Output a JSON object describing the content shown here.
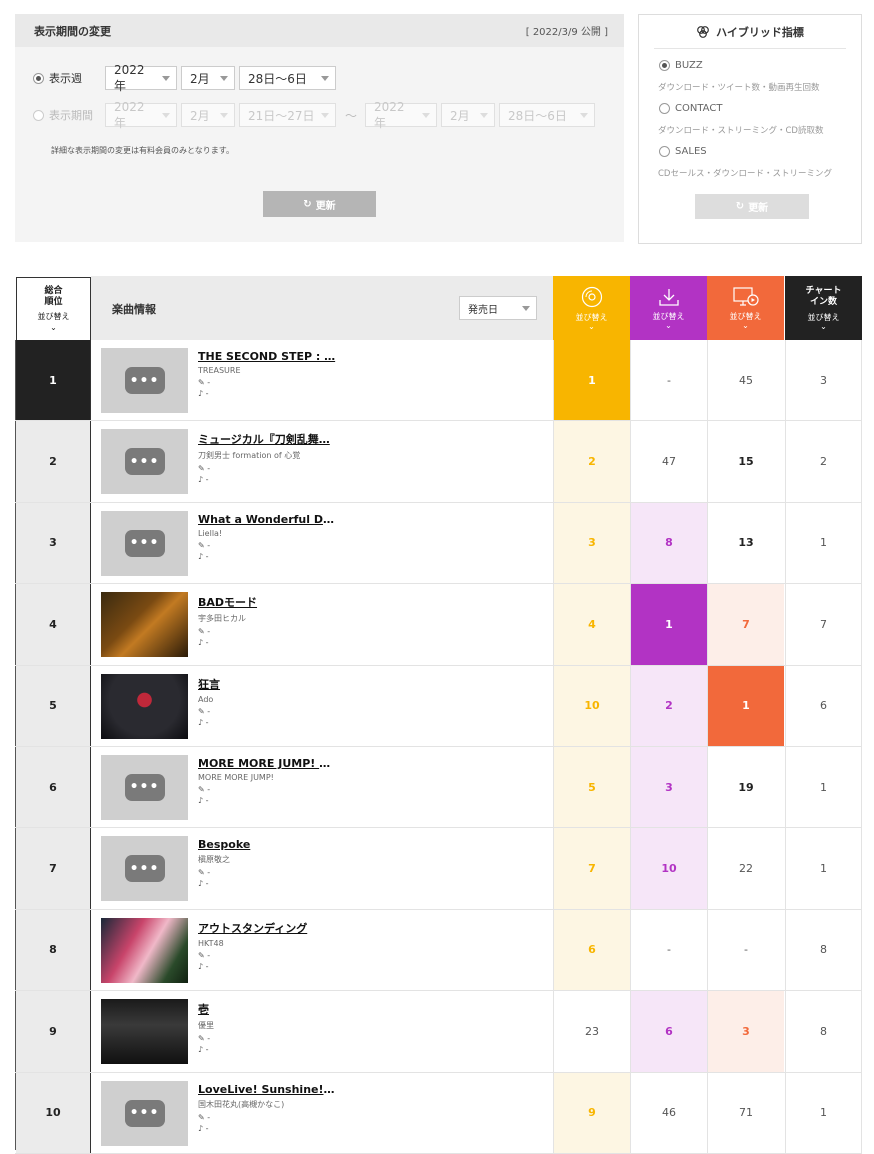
{
  "period": {
    "title": "表示期間の変更",
    "published": "[ 2022/3/9 公開 ]",
    "week_label": "表示週",
    "week": {
      "year": "2022年",
      "month": "2月",
      "range": "28日〜6日"
    },
    "span_label": "表示期間",
    "span_from": {
      "year": "2022年",
      "month": "2月",
      "range": "21日〜27日"
    },
    "span_sep": "〜",
    "span_to": {
      "year": "2022年",
      "month": "2月",
      "range": "28日〜6日"
    },
    "note": "詳細な表示期間の変更は有料会員のみとなります。",
    "update_label": "更新"
  },
  "hybrid": {
    "title": "ハイブリッド指標",
    "options": [
      {
        "label": "BUZZ",
        "desc": "ダウンロード・ツイート数・動画再生回数",
        "selected": true
      },
      {
        "label": "CONTACT",
        "desc": "ダウンロード・ストリーミング・CD読取数",
        "selected": false
      },
      {
        "label": "SALES",
        "desc": "CDセールス・ダウンロード・ストリーミング",
        "selected": false
      }
    ],
    "update_label": "更新"
  },
  "table": {
    "rank_header": [
      "総合",
      "順位"
    ],
    "sort_label": "並び替え",
    "song_header": "楽曲情報",
    "sort_select": "発売日",
    "chart_in_header": [
      "チャート",
      "イン数"
    ],
    "icons": {
      "cd": "cd-icon",
      "download": "download-icon",
      "streaming": "streaming-icon"
    },
    "colors": {
      "cd": "#f8b500",
      "download": "#b233c4",
      "streaming": "#f2693b",
      "chart_in": "#222222"
    }
  },
  "rows": [
    {
      "rank": "1",
      "title": "THE SECOND STEP : …",
      "artist": "TREASURE",
      "lyricist": "-",
      "composer": "-",
      "cd": "1",
      "dl": "-",
      "st": "45",
      "in": "3"
    },
    {
      "rank": "2",
      "title": "ミュージカル『刀剣乱舞…",
      "artist": "刀剣男士 formation of 心覚",
      "lyricist": "-",
      "composer": "-",
      "cd": "2",
      "dl": "47",
      "st": "15",
      "in": "2"
    },
    {
      "rank": "3",
      "title": "What a Wonderful Dre…",
      "artist": "Liella!",
      "lyricist": "-",
      "composer": "-",
      "cd": "3",
      "dl": "8",
      "st": "13",
      "in": "1"
    },
    {
      "rank": "4",
      "title": "BADモード",
      "artist": "宇多田ヒカル",
      "lyricist": "-",
      "composer": "-",
      "cd": "4",
      "dl": "1",
      "st": "7",
      "in": "7"
    },
    {
      "rank": "5",
      "title": "狂言",
      "artist": "Ado",
      "lyricist": "-",
      "composer": "-",
      "cd": "10",
      "dl": "2",
      "st": "1",
      "in": "6"
    },
    {
      "rank": "6",
      "title": "MORE MORE JUMP! S…",
      "artist": "MORE MORE JUMP!",
      "lyricist": "-",
      "composer": "-",
      "cd": "5",
      "dl": "3",
      "st": "19",
      "in": "1"
    },
    {
      "rank": "7",
      "title": "Bespoke",
      "artist": "槇原敬之",
      "lyricist": "-",
      "composer": "-",
      "cd": "7",
      "dl": "10",
      "st": "22",
      "in": "1"
    },
    {
      "rank": "8",
      "title": "アウトスタンディング",
      "artist": "HKT48",
      "lyricist": "-",
      "composer": "-",
      "cd": "6",
      "dl": "-",
      "st": "-",
      "in": "8"
    },
    {
      "rank": "9",
      "title": "壱",
      "artist": "優里",
      "lyricist": "-",
      "composer": "-",
      "cd": "23",
      "dl": "6",
      "st": "3",
      "in": "8"
    },
    {
      "rank": "10",
      "title": "LoveLive! Sunshine!! …",
      "artist": "国木田花丸(高槻かなこ)",
      "lyricist": "-",
      "composer": "-",
      "cd": "9",
      "dl": "46",
      "st": "71",
      "in": "1"
    }
  ]
}
